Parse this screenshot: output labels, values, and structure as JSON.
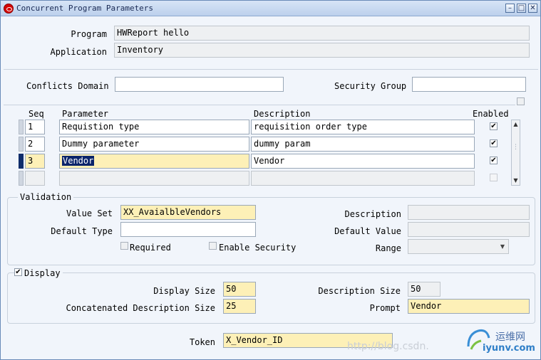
{
  "window": {
    "title": "Concurrent Program Parameters"
  },
  "header": {
    "program_label": "Program",
    "program_value": "HWReport hello",
    "application_label": "Application",
    "application_value": "Inventory"
  },
  "security": {
    "conflicts_domain_label": "Conflicts Domain",
    "conflicts_domain_value": "",
    "security_group_label": "Security Group",
    "security_group_value": ""
  },
  "grid": {
    "headers": {
      "seq": "Seq",
      "parameter": "Parameter",
      "description": "Description",
      "enabled": "Enabled"
    },
    "rows": [
      {
        "seq": "1",
        "parameter": "Requistion type",
        "description": "requisition order type",
        "enabled": "✔"
      },
      {
        "seq": "2",
        "parameter": "Dummy parameter",
        "description": "dummy param",
        "enabled": "✔"
      },
      {
        "seq": "3",
        "parameter": "Vendor",
        "description": "Vendor",
        "enabled": "✔"
      },
      {
        "seq": "",
        "parameter": "",
        "description": "",
        "enabled": ""
      }
    ]
  },
  "validation": {
    "title": "Validation",
    "value_set_label": "Value Set",
    "value_set_value": "XX_AvaialbleVendors",
    "description_label": "Description",
    "description_value": "",
    "default_type_label": "Default Type",
    "default_type_value": "",
    "default_value_label": "Default Value",
    "default_value_value": "",
    "required_label": "Required",
    "enable_security_label": "Enable Security",
    "range_label": "Range",
    "range_value": ""
  },
  "display": {
    "title": "Display",
    "checked": "✔",
    "display_size_label": "Display Size",
    "display_size_value": "50",
    "description_size_label": "Description Size",
    "description_size_value": "50",
    "concat_size_label": "Concatenated Description Size",
    "concat_size_value": "25",
    "prompt_label": "Prompt",
    "prompt_value": "Vendor"
  },
  "token": {
    "label": "Token",
    "value": "X_Vendor_ID"
  },
  "watermark": {
    "url": "http://blog.csdn.",
    "brand": "运维网",
    "site": "iyunv.com"
  },
  "icons": [
    "oracle-logo-icon",
    "minimize-icon",
    "maximize-icon",
    "close-icon",
    "check-icon",
    "scroll-up-icon",
    "scroll-down-icon",
    "chevron-down-icon"
  ]
}
